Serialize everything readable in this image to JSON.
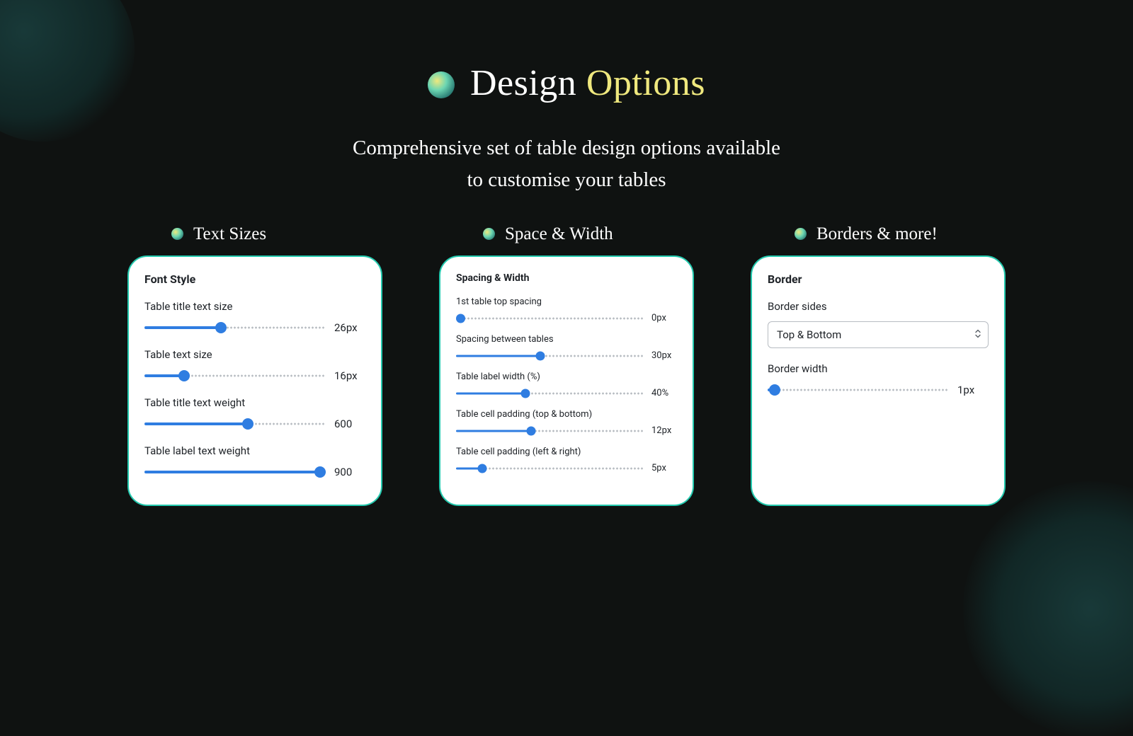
{
  "header": {
    "title_prefix": "Design",
    "title_accent": "Options",
    "subtitle_line1": "Comprehensive set of table design options available",
    "subtitle_line2": "to customise your tables"
  },
  "columns": [
    {
      "title": "Text Sizes"
    },
    {
      "title": "Space & Width"
    },
    {
      "title": "Borders & more!"
    }
  ],
  "card_font": {
    "heading": "Font Style",
    "items": [
      {
        "label": "Table title text size",
        "value": "26px",
        "fill": 42
      },
      {
        "label": "Table text size",
        "value": "16px",
        "fill": 22
      },
      {
        "label": "Table title text weight",
        "value": "600",
        "fill": 57
      },
      {
        "label": "Table label text weight",
        "value": "900",
        "fill": 100
      }
    ]
  },
  "card_space": {
    "heading": "Spacing & Width",
    "items": [
      {
        "label": "1st table top spacing",
        "value": "0px",
        "fill": 0
      },
      {
        "label": "Spacing between tables",
        "value": "30px",
        "fill": 45
      },
      {
        "label": "Table label width (%)",
        "value": "40%",
        "fill": 37
      },
      {
        "label": "Table cell padding (top & bottom)",
        "value": "12px",
        "fill": 40
      },
      {
        "label": "Table cell padding (left & right)",
        "value": "5px",
        "fill": 14
      }
    ]
  },
  "card_border": {
    "heading": "Border",
    "sides_label": "Border sides",
    "sides_value": "Top & Bottom",
    "width_label": "Border width",
    "width_value": "1px",
    "width_fill": 4
  }
}
